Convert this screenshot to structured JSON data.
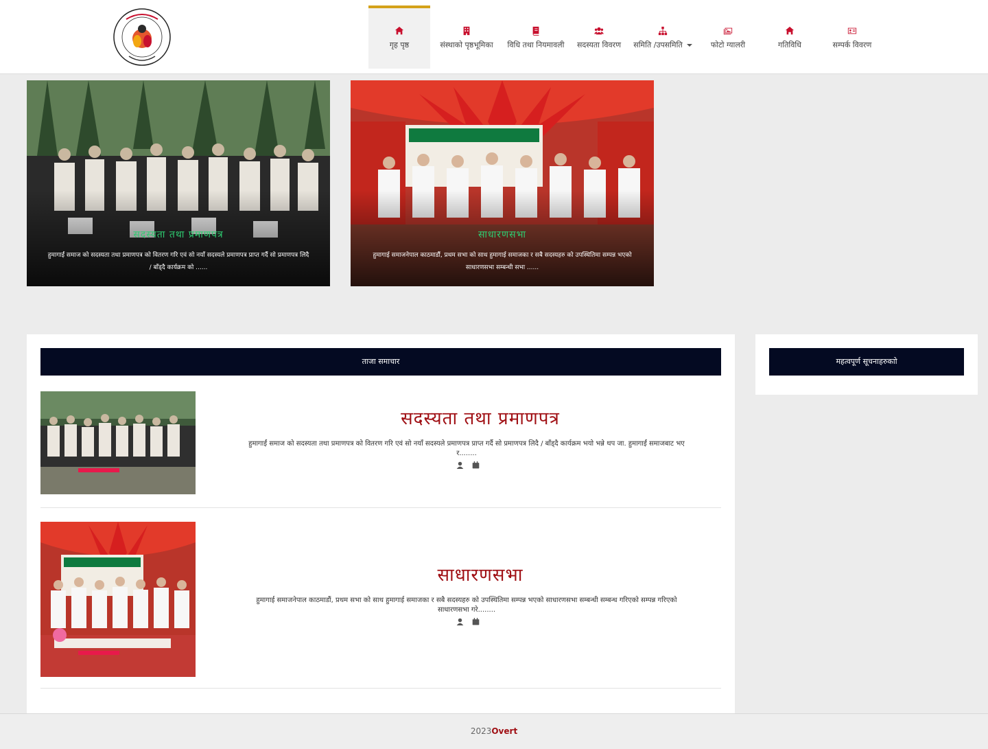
{
  "brand": {
    "logo_text_top": "हुमागाई समाज नेपाल",
    "logo_text_bottom": "काठमाडौं नेपाल",
    "logo_year": "स्था २०६८"
  },
  "nav": {
    "items": [
      {
        "label": "गृह पृष्ठ",
        "icon": "home-icon"
      },
      {
        "label": "संस्थाको पृष्ठभूमिका",
        "icon": "building-icon"
      },
      {
        "label": "विधि तथा नियमावली",
        "icon": "book-icon"
      },
      {
        "label": "सदस्यता विवरण",
        "icon": "users-icon"
      },
      {
        "label": "समिति /उपसमिति",
        "icon": "sitemap-icon"
      },
      {
        "label": "फोटो ग्यालरी",
        "icon": "images-icon"
      },
      {
        "label": "गतिविधि",
        "icon": "home-icon"
      },
      {
        "label": "सम्पर्क विवरण",
        "icon": "id-card-icon"
      }
    ]
  },
  "slider": [
    {
      "title": "सदस्यता तथा प्रमाणपत्र",
      "text": "हुमागाईं समाज को सदस्यता तथा प्रमाणपत्र को वितरण गरि एवं सो नयाँ सदस्यले प्रमाणपत्र प्राप्त गर्दै सो प्रमाणपत्र लिदै / बाँड्दै कार्यक्रम को ......"
    },
    {
      "title": "साधारणसभा",
      "text": "हुमागाई समाजनेपाल काठमाडौं, प्रथम सभा को साथ हुमागाई समाजका र सबै सदस्यहरु को उपस्थितिमा सम्पन्न भएको साधारणसभा सम्बन्धी सभा ......"
    }
  ],
  "main": {
    "section_title": "ताजा समाचार",
    "news": [
      {
        "title": "सदस्यता तथा प्रमाणपत्र",
        "text": "हुमागाईं समाज को सदस्यता तथा प्रमाणपत्र को वितरण गरि एवं सो नयाँ सदस्यले प्रमाणपत्र प्राप्त गर्दै सो प्रमाणपत्र लिदै / बाँड्दै कार्यक्रम भयो भन्ने थप जा. हुमागाईं समाजबाट भए र........"
      },
      {
        "title": "साधारणसभा",
        "text": "हुमागाई समाजनेपाल काठमाडौं, प्रथम सभा को साथ हुमागाई समाजका र सबै सदस्यहरु को उपस्थितिमा सम्पन्न भएको साधारणसभा सम्बन्धी सम्बन्ध गरिएको सम्पन्न गरिएको साधारणसभा गरे........"
      }
    ]
  },
  "sidebar": {
    "title": "महत्वपूर्ण सूचनाहरुकाो"
  },
  "footer": {
    "year": "2023",
    "brand": "Overt"
  },
  "colors": {
    "accent_red": "#c8102e",
    "nav_active_border": "#d4a21a",
    "dark_bar": "#040a22",
    "slide_title": "#2ecc71"
  }
}
